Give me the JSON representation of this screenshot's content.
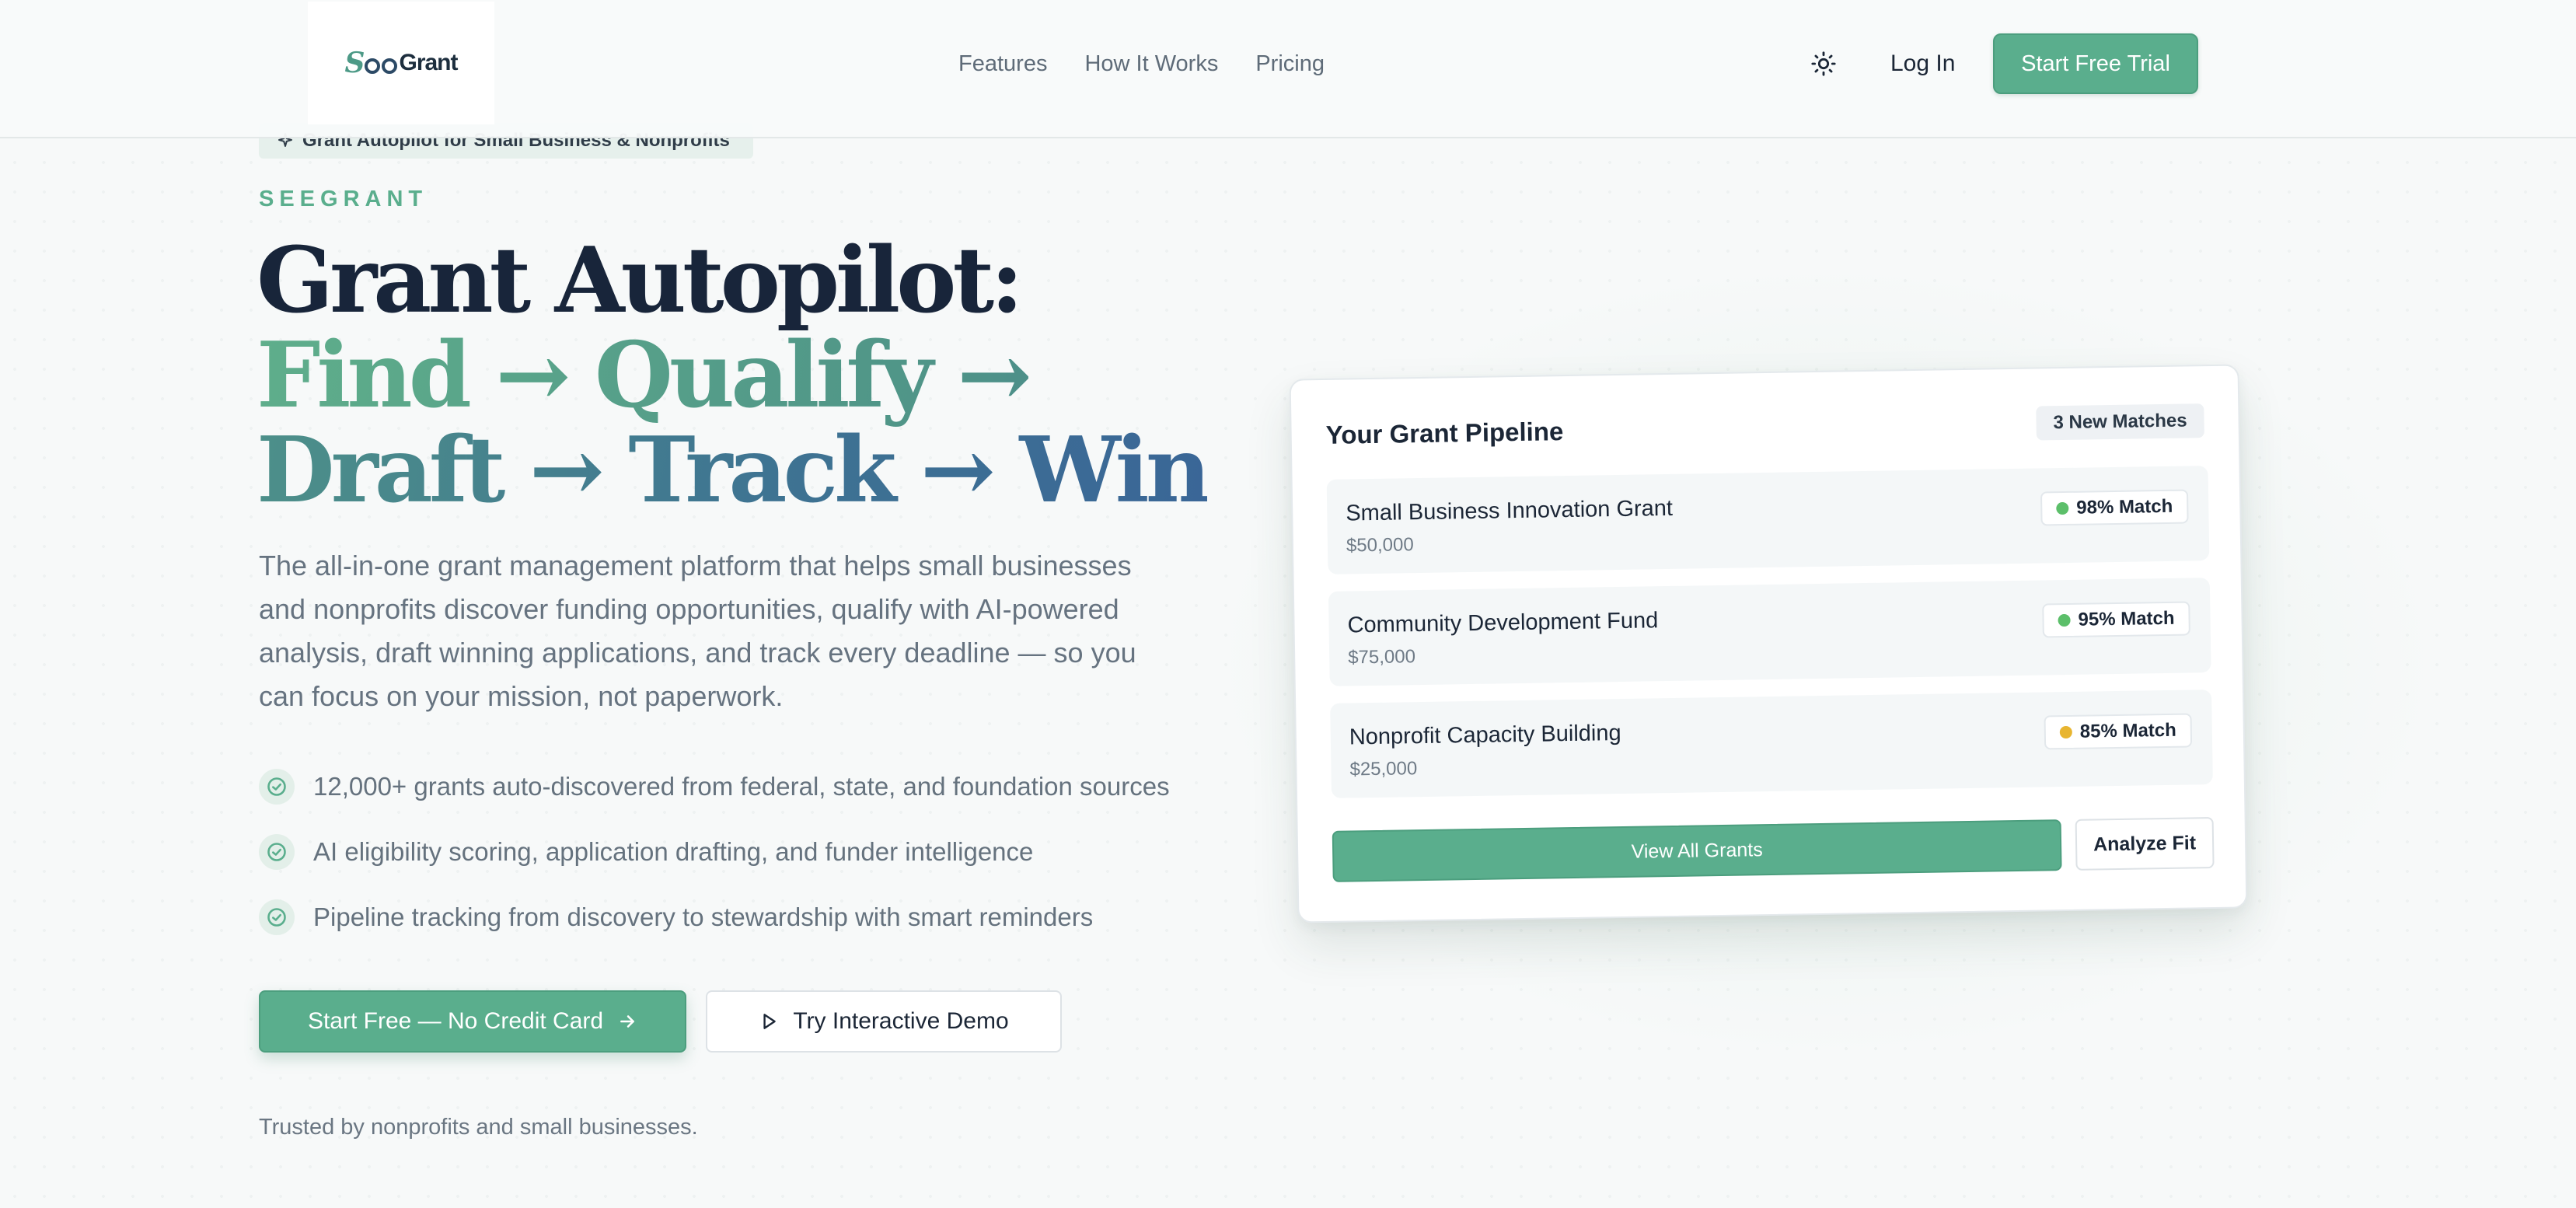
{
  "nav": {
    "logo": {
      "mark_prefix": "S",
      "mark_suffix": "",
      "word": "Grant"
    },
    "links": [
      "Features",
      "How It Works",
      "Pricing"
    ],
    "theme_icon": "sun-icon",
    "login_label": "Log In",
    "cta_label": "Start Free Trial"
  },
  "hero": {
    "badge": {
      "icon": "sparkle-icon",
      "text": "Grant Autopilot for Small Business & Nonprofits"
    },
    "eyebrow": "SEEGRANT",
    "headline": {
      "lead": "Grant Autopilot:",
      "accent": "Find → Qualify → Draft → Track → Win"
    },
    "description": "The all-in-one grant management platform that helps small businesses and nonprofits discover funding opportunities, qualify with AI-powered analysis, draft winning applications, and track every deadline — so you can focus on your mission, not paperwork.",
    "features": [
      {
        "icon": "check-circle-icon",
        "text": "12,000+ grants auto-discovered from federal, state, and foundation sources"
      },
      {
        "icon": "check-circle-icon",
        "text": "AI eligibility scoring, application drafting, and funder intelligence"
      },
      {
        "icon": "check-circle-icon",
        "text": "Pipeline tracking from discovery to stewardship with smart reminders"
      }
    ],
    "primary_cta": {
      "label": "Start Free — No Credit Card",
      "icon": "arrow-right-icon"
    },
    "secondary_cta": {
      "label": "Try Interactive Demo",
      "icon": "play-icon"
    },
    "trusted_text": "Trusted by nonprofits and small businesses."
  },
  "pipeline": {
    "title": "Your Grant Pipeline",
    "badge": "3 New Matches",
    "grants": [
      {
        "name": "Small Business Innovation Grant",
        "amount": "$50,000",
        "match": "98% Match",
        "dot_color": "#5cbf6a"
      },
      {
        "name": "Community Development Fund",
        "amount": "$75,000",
        "match": "95% Match",
        "dot_color": "#5cbf6a"
      },
      {
        "name": "Nonprofit Capacity Building",
        "amount": "$25,000",
        "match": "85% Match",
        "dot_color": "#e8b530"
      }
    ],
    "view_all_label": "View All Grants",
    "analyze_label": "Analyze Fit"
  },
  "colors": {
    "brand_green": "#5aae8d",
    "headline_dark": "#18253a",
    "headline_blue": "#3a6697",
    "text_muted": "#667380"
  }
}
